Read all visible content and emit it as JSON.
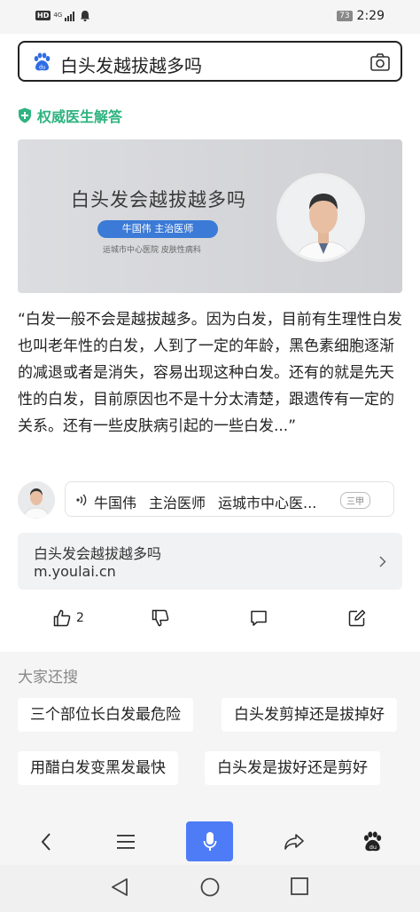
{
  "status_bar": {
    "hd": "HD",
    "network": "4G",
    "battery": "73",
    "time": "2:29"
  },
  "search": {
    "query": "白头发越拔越多吗"
  },
  "answer": {
    "badge": "权威医生解答",
    "video": {
      "title": "白头发会越拔越多吗",
      "doctor_pill": "牛国伟 主治医师",
      "hospital_line": "运城市中心医院 皮肤性病科"
    },
    "quote": "“白发一般不会是越拔越多。因为白发，目前有生理性白发也叫老年性的白发，人到了一定的年龄，黑色素细胞逐渐的减退或者是消失，容易出现这种白发。还有的就是先天性的白发，目前原因也不是十分太清楚，跟遗传有一定的关系。还有一些皮肤病引起的一些白发...”",
    "doctor": {
      "name": "牛国伟",
      "title": "主治医师",
      "hospital": "运城市中心医...",
      "tier": "三甲"
    },
    "source": {
      "title": "白头发会越拔越多吗",
      "url": "m.youlai.cn"
    },
    "actions": {
      "like_count": "2"
    }
  },
  "also_search": {
    "title": "大家还搜",
    "items": [
      "三个部位长白发最危险",
      "白头发剪掉还是拔掉好",
      "用醋白发变黑发最快",
      "白头发是拔好还是剪好"
    ]
  },
  "colors": {
    "accent_green": "#2fb380",
    "mic_blue": "#4e7cf6",
    "pill_blue": "#3b7ad6"
  }
}
